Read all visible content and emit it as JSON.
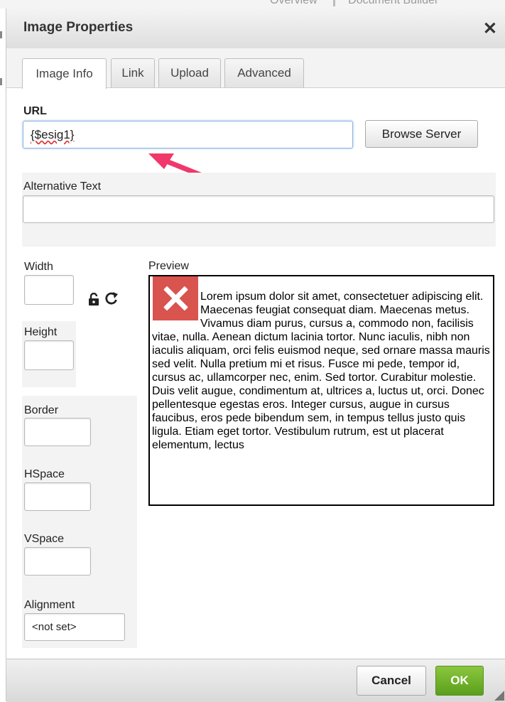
{
  "background": {
    "tab_overview": "Overview",
    "tab_builder": "Document Builder"
  },
  "dialog": {
    "title": "Image Properties",
    "close_glyph": "✕",
    "tabs": [
      {
        "label": "Image Info",
        "active": true
      },
      {
        "label": "Link",
        "active": false
      },
      {
        "label": "Upload",
        "active": false
      },
      {
        "label": "Advanced",
        "active": false
      }
    ],
    "url": {
      "label": "URL",
      "value": "{$esig1}"
    },
    "browse_button": "Browse Server",
    "alt_text": {
      "label": "Alternative Text",
      "value": ""
    },
    "width": {
      "label": "Width",
      "value": ""
    },
    "height": {
      "label": "Height",
      "value": ""
    },
    "lock_icon": "lock-icon",
    "reset_icon": "reset-size-icon",
    "border": {
      "label": "Border",
      "value": ""
    },
    "hspace": {
      "label": "HSpace",
      "value": ""
    },
    "vspace": {
      "label": "VSpace",
      "value": ""
    },
    "alignment": {
      "label": "Alignment",
      "value": "<not set>"
    },
    "preview": {
      "label": "Preview",
      "text": "Lorem ipsum dolor sit amet, consectetuer adipiscing elit. Maecenas feugiat consequat diam. Maecenas metus. Vivamus diam purus, cursus a, commodo non, facilisis vitae, nulla. Aenean dictum lacinia tortor. Nunc iaculis, nibh non iaculis aliquam, orci felis euismod neque, sed ornare massa mauris sed velit. Nulla pretium mi et risus. Fusce mi pede, tempor id, cursus ac, ullamcorper nec, enim. Sed tortor. Curabitur molestie. Duis velit augue, condimentum at, ultrices a, luctus ut, orci. Donec pellentesque egestas eros. Integer cursus, augue in cursus faucibus, eros pede bibendum sem, in tempus tellus justo quis ligula. Etiam eget tortor. Vestibulum rutrum, est ut placerat elementum, lectus"
    },
    "cancel_button": "Cancel",
    "ok_button": "OK",
    "colors": {
      "ok_green": "#6aaf2b",
      "annotation_arrow": "#f0386b",
      "focus_blue": "#8fb3e0"
    }
  }
}
